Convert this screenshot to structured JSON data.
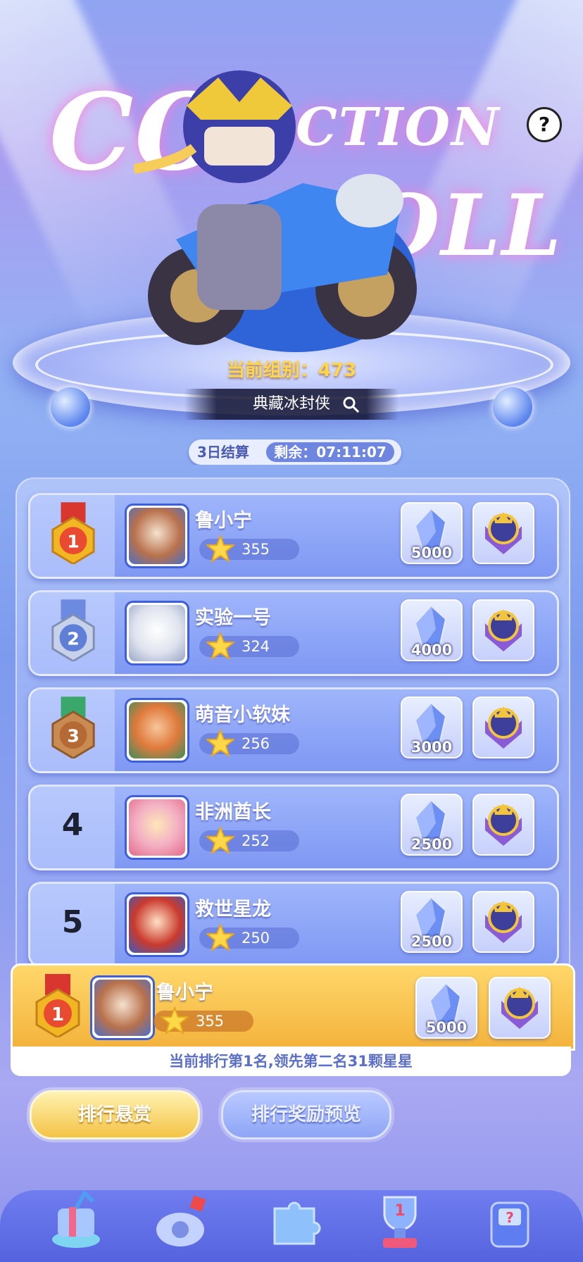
{
  "hero": {
    "bg_text_line1": "CO",
    "bg_text_line1b": "CTION",
    "bg_text_line2": "OLL",
    "group_label": "当前组别：473",
    "collection_name": "典藏冰封侠"
  },
  "timer": {
    "cycle": "3日结算",
    "remaining": "剩余：07:11:07"
  },
  "ranking": [
    {
      "rank": "1",
      "medal": "gold",
      "name": "鲁小宁",
      "score": "355",
      "crystal": "5000"
    },
    {
      "rank": "2",
      "medal": "silver",
      "name": "实验一号",
      "score": "324",
      "crystal": "4000"
    },
    {
      "rank": "3",
      "medal": "bronze",
      "name": "萌音小软妹",
      "score": "256",
      "crystal": "3000"
    },
    {
      "rank": "4",
      "medal": "",
      "name": "非洲酋长",
      "score": "252",
      "crystal": "2500"
    },
    {
      "rank": "5",
      "medal": "",
      "name": "救世星龙",
      "score": "250",
      "crystal": "2500"
    }
  ],
  "me": {
    "rank": "1",
    "name": "鲁小宁",
    "score": "355",
    "crystal": "5000",
    "note": "当前排行第1名,领先第二名31颗星星"
  },
  "buttons": {
    "bounty": "排行悬赏",
    "preview": "排行奖励预览"
  },
  "help_label": "?",
  "nav_icons": [
    "gift-icon",
    "car-part-icon",
    "puzzle-icon",
    "trophy-icon",
    "mystery-machine-icon"
  ],
  "colors": {
    "accent": "#ffd54a",
    "panel": "#8fa6f6",
    "highlight": "#f3b33b"
  }
}
